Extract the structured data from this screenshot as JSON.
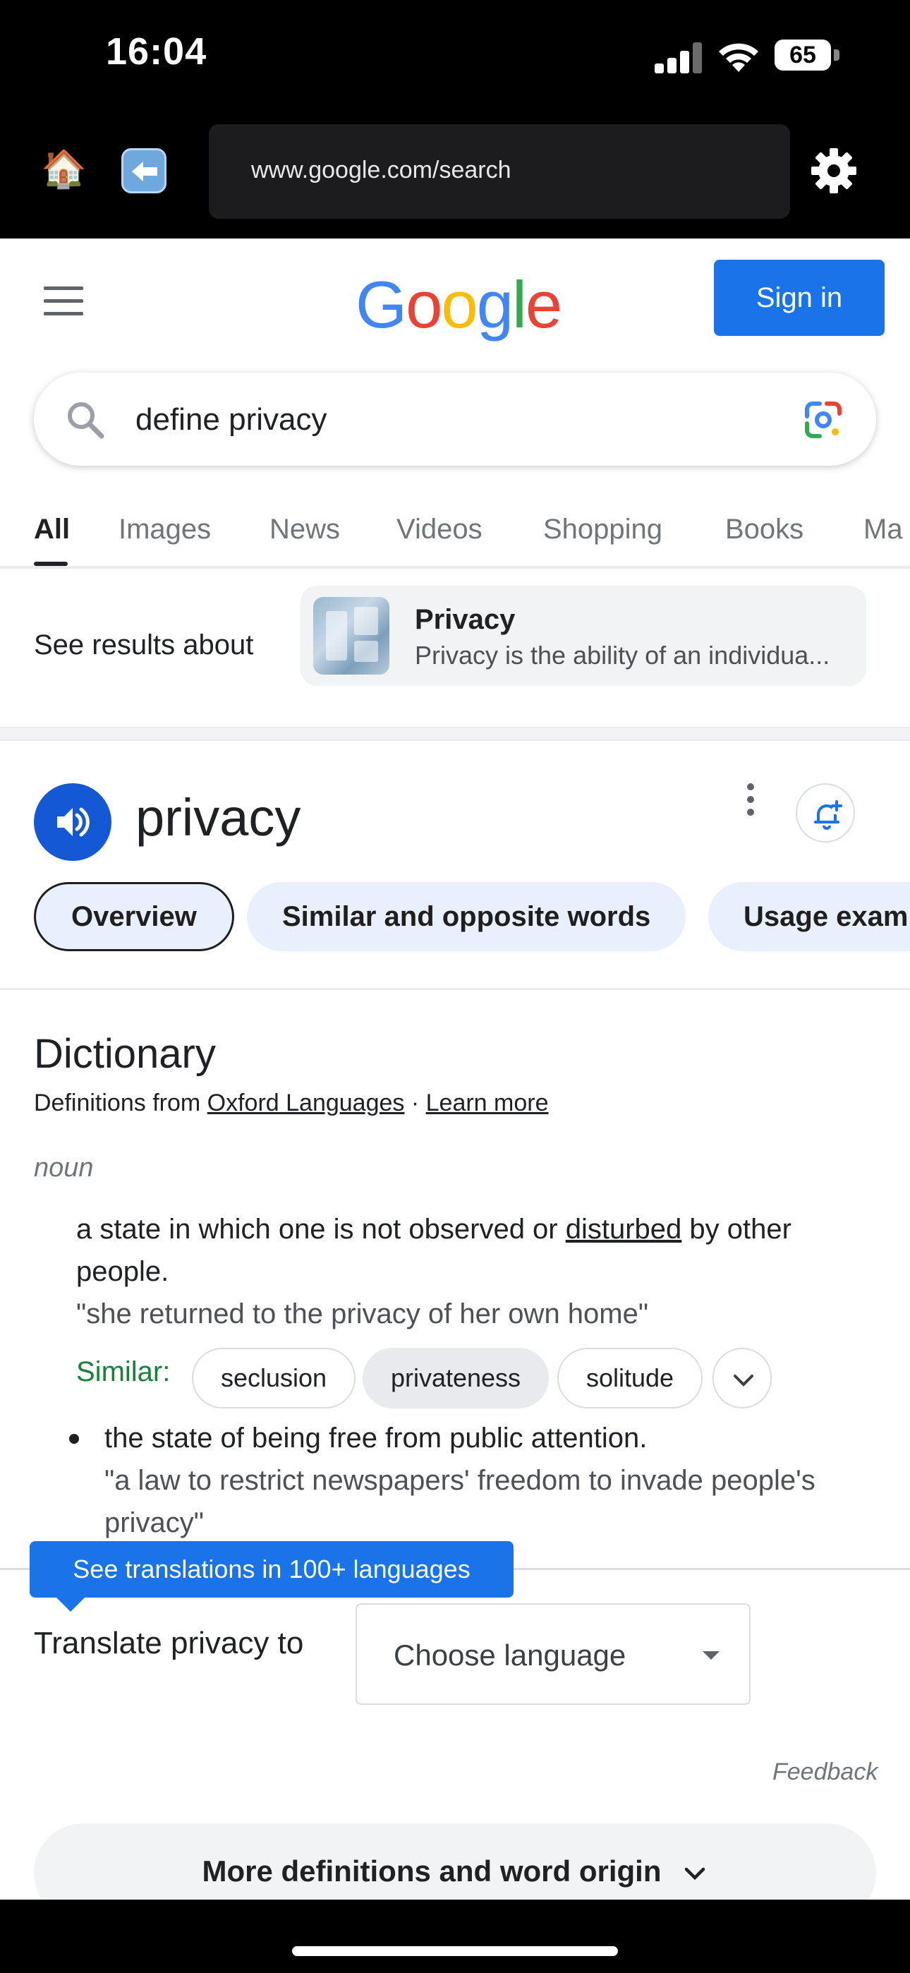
{
  "status_bar": {
    "time": "16:04",
    "battery": "65"
  },
  "browser": {
    "url": "www.google.com/search"
  },
  "header": {
    "sign_in": "Sign in"
  },
  "search": {
    "query": "define privacy"
  },
  "tabs": [
    "All",
    "Images",
    "News",
    "Videos",
    "Shopping",
    "Books",
    "Ma"
  ],
  "about": {
    "label": "See results about",
    "title": "Privacy",
    "description": "Privacy is the ability of an individua..."
  },
  "word": {
    "headword": "privacy"
  },
  "chips": [
    "Overview",
    "Similar and opposite words",
    "Usage exam"
  ],
  "dictionary": {
    "title": "Dictionary",
    "source_prefix": "Definitions from ",
    "source_link": "Oxford Languages",
    "source_sep": " · ",
    "learn_more": "Learn more",
    "part_of_speech": "noun",
    "def1_before": "a state in which one is not observed or ",
    "def1_link": "disturbed",
    "def1_after": " by other people.",
    "example1": "\"she returned to the privacy of her own home\"",
    "similar_label": "Similar:",
    "similar_words": [
      "seclusion",
      "privateness",
      "solitude"
    ],
    "def2": "the state of being free from public attention.",
    "example2": "\"a law to restrict newspapers' freedom to invade people's privacy\""
  },
  "translate": {
    "tooltip": "See translations in 100+ languages",
    "label": "Translate privacy to",
    "select_placeholder": "Choose language"
  },
  "feedback": "Feedback",
  "more_definitions": "More definitions and word origin"
}
